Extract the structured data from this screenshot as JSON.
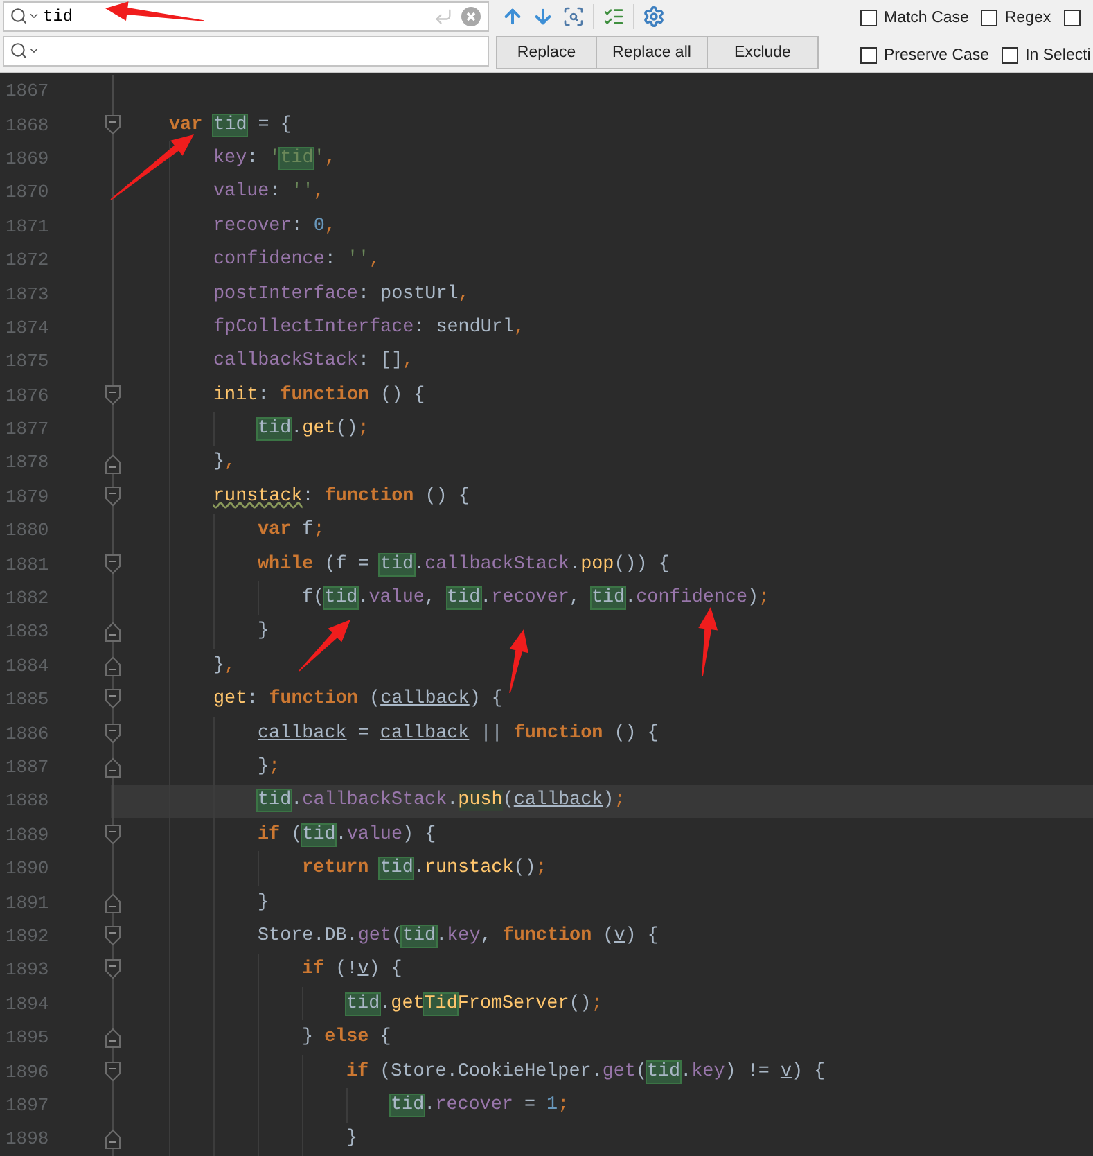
{
  "find_bar": {
    "search": {
      "value": "tid"
    },
    "buttons": [
      {
        "label": "Replace"
      },
      {
        "label": "Replace all"
      },
      {
        "label": "Exclude"
      }
    ],
    "options": [
      {
        "label": "Match Case",
        "checked": false
      },
      {
        "label": "Regex",
        "checked": false
      },
      {
        "checked": false
      },
      {
        "label": "Preserve Case",
        "checked": false
      },
      {
        "label": "In Selecti",
        "checked": false
      }
    ]
  },
  "editor": {
    "lines": [
      {
        "number": "1867",
        "kind": "code",
        "current": false
      },
      {
        "number": "1868",
        "kind": "block_start",
        "current": false,
        "tokens": [
          {
            "text": "var ",
            "kind": "kw"
          },
          {
            "text": "tid",
            "kind": "match"
          },
          {
            "text": " = {",
            "kind": "plain"
          }
        ],
        "children": [
          {
            "number": "1869",
            "kind": "code",
            "current": false,
            "tokens": [
              {
                "text": "key",
                "kind": "prop"
              },
              {
                "text": ": ",
                "kind": "plain"
              },
              {
                "text": "'",
                "kind": "str"
              },
              {
                "text": "tid",
                "kind": "match_str"
              },
              {
                "text": "'",
                "kind": "str"
              },
              {
                "text": ",",
                "kind": "punct"
              }
            ]
          },
          {
            "number": "1870",
            "kind": "code",
            "current": false,
            "tokens": [
              {
                "text": "value",
                "kind": "prop"
              },
              {
                "text": ": ",
                "kind": "plain"
              },
              {
                "text": "''",
                "kind": "str"
              },
              {
                "text": ",",
                "kind": "punct"
              }
            ]
          },
          {
            "number": "1871",
            "kind": "code",
            "current": false,
            "tokens": [
              {
                "text": "recover",
                "kind": "prop"
              },
              {
                "text": ": ",
                "kind": "plain"
              },
              {
                "text": "0",
                "kind": "num"
              },
              {
                "text": ",",
                "kind": "punct"
              }
            ]
          },
          {
            "number": "1872",
            "kind": "code",
            "current": false,
            "tokens": [
              {
                "text": "confidence",
                "kind": "prop"
              },
              {
                "text": ": ",
                "kind": "plain"
              },
              {
                "text": "''",
                "kind": "str"
              },
              {
                "text": ",",
                "kind": "punct"
              }
            ]
          },
          {
            "number": "1873",
            "kind": "code",
            "current": false,
            "tokens": [
              {
                "text": "postInterface",
                "kind": "prop"
              },
              {
                "text": ": postUrl",
                "kind": "plain"
              },
              {
                "text": ",",
                "kind": "punct"
              }
            ]
          },
          {
            "number": "1874",
            "kind": "code",
            "current": false,
            "tokens": [
              {
                "text": "fpCollectInterface",
                "kind": "prop"
              },
              {
                "text": ": sendUrl",
                "kind": "plain"
              },
              {
                "text": ",",
                "kind": "punct"
              }
            ]
          },
          {
            "number": "1875",
            "kind": "code",
            "current": false,
            "tokens": [
              {
                "text": "callbackStack",
                "kind": "prop"
              },
              {
                "text": ": []",
                "kind": "plain"
              },
              {
                "text": ",",
                "kind": "punct"
              }
            ]
          },
          {
            "number": "1876",
            "kind": "block_start",
            "current": false,
            "tokens": [
              {
                "text": "init",
                "kind": "fn"
              },
              {
                "text": ": ",
                "kind": "plain"
              },
              {
                "text": "function",
                "kind": "kw"
              },
              {
                "text": " () {",
                "kind": "plain"
              }
            ],
            "children": [
              {
                "number": "1877",
                "kind": "code",
                "current": false,
                "tokens": [
                  {
                    "text": "tid",
                    "kind": "match"
                  },
                  {
                    "text": ".",
                    "kind": "plain"
                  },
                  {
                    "text": "get",
                    "kind": "fn"
                  },
                  {
                    "text": "()",
                    "kind": "plain"
                  },
                  {
                    "text": ";",
                    "kind": "punct"
                  }
                ]
              }
            ]
          },
          {
            "number": "1878",
            "kind": "block_end",
            "current": false,
            "tokens": [
              {
                "text": "}",
                "kind": "plain"
              },
              {
                "text": ",",
                "kind": "punct"
              }
            ]
          },
          {
            "number": "1879",
            "kind": "block_start",
            "current": false,
            "tokens": [
              {
                "text": "runstack",
                "kind": "fn_warn"
              },
              {
                "text": ": ",
                "kind": "plain"
              },
              {
                "text": "function",
                "kind": "kw"
              },
              {
                "text": " () {",
                "kind": "plain"
              }
            ],
            "children": [
              {
                "number": "1880",
                "kind": "code",
                "current": false,
                "tokens": [
                  {
                    "text": "var",
                    "kind": "kw"
                  },
                  {
                    "text": " f",
                    "kind": "plain"
                  },
                  {
                    "text": ";",
                    "kind": "punct"
                  }
                ]
              },
              {
                "number": "1881",
                "kind": "block_start",
                "current": false,
                "tokens": [
                  {
                    "text": "while",
                    "kind": "kw"
                  },
                  {
                    "text": " (f = ",
                    "kind": "plain"
                  },
                  {
                    "text": "tid",
                    "kind": "match"
                  },
                  {
                    "text": ".",
                    "kind": "plain"
                  },
                  {
                    "text": "callbackStack",
                    "kind": "prop"
                  },
                  {
                    "text": ".",
                    "kind": "plain"
                  },
                  {
                    "text": "pop",
                    "kind": "fn"
                  },
                  {
                    "text": "()) {",
                    "kind": "plain"
                  }
                ],
                "children": [
                  {
                    "number": "1882",
                    "kind": "code",
                    "current": false,
                    "tokens": [
                      {
                        "text": "f(",
                        "kind": "plain"
                      },
                      {
                        "text": "tid",
                        "kind": "match"
                      },
                      {
                        "text": ".",
                        "kind": "plain"
                      },
                      {
                        "text": "value",
                        "kind": "prop"
                      },
                      {
                        "text": ", ",
                        "kind": "plain"
                      },
                      {
                        "text": "tid",
                        "kind": "match"
                      },
                      {
                        "text": ".",
                        "kind": "plain"
                      },
                      {
                        "text": "recover",
                        "kind": "prop"
                      },
                      {
                        "text": ", ",
                        "kind": "plain"
                      },
                      {
                        "text": "tid",
                        "kind": "match"
                      },
                      {
                        "text": ".",
                        "kind": "plain"
                      },
                      {
                        "text": "confidence",
                        "kind": "prop"
                      },
                      {
                        "text": ")",
                        "kind": "plain"
                      },
                      {
                        "text": ";",
                        "kind": "punct"
                      }
                    ]
                  }
                ]
              },
              {
                "number": "1883",
                "kind": "block_end",
                "current": false,
                "tokens": [
                  {
                    "text": "}",
                    "kind": "plain"
                  }
                ]
              }
            ]
          },
          {
            "number": "1884",
            "kind": "block_end",
            "current": false,
            "tokens": [
              {
                "text": "}",
                "kind": "plain"
              },
              {
                "text": ",",
                "kind": "punct"
              }
            ]
          },
          {
            "number": "1885",
            "kind": "block_start",
            "current": false,
            "tokens": [
              {
                "text": "get",
                "kind": "fn"
              },
              {
                "text": ": ",
                "kind": "plain"
              },
              {
                "text": "function",
                "kind": "kw"
              },
              {
                "text": " (",
                "kind": "plain"
              },
              {
                "text": "callback",
                "kind": "param"
              },
              {
                "text": ") {",
                "kind": "plain"
              }
            ],
            "children": [
              {
                "number": "1886",
                "kind": "block_start",
                "current": false,
                "tokens": [
                  {
                    "text": "callback",
                    "kind": "param"
                  },
                  {
                    "text": " = ",
                    "kind": "plain"
                  },
                  {
                    "text": "callback",
                    "kind": "param"
                  },
                  {
                    "text": " || ",
                    "kind": "plain"
                  },
                  {
                    "text": "function",
                    "kind": "kw"
                  },
                  {
                    "text": " () {",
                    "kind": "plain"
                  }
                ]
              },
              {
                "number": "1887",
                "kind": "block_end",
                "current": false,
                "tokens": [
                  {
                    "text": "}",
                    "kind": "plain"
                  },
                  {
                    "text": ";",
                    "kind": "punct"
                  }
                ]
              },
              {
                "number": "1888",
                "kind": "code",
                "current": true,
                "tokens": [
                  {
                    "text": "tid",
                    "kind": "match"
                  },
                  {
                    "text": ".",
                    "kind": "plain"
                  },
                  {
                    "text": "callbackStack",
                    "kind": "prop"
                  },
                  {
                    "text": ".",
                    "kind": "plain"
                  },
                  {
                    "text": "push",
                    "kind": "fn_hl"
                  },
                  {
                    "text": "(",
                    "kind": "plain"
                  },
                  {
                    "text": "callback",
                    "kind": "param"
                  },
                  {
                    "text": ")",
                    "kind": "plain"
                  },
                  {
                    "text": ";",
                    "kind": "punct"
                  }
                ]
              },
              {
                "number": "1889",
                "kind": "block_start",
                "current": false,
                "tokens": [
                  {
                    "text": "if",
                    "kind": "kw"
                  },
                  {
                    "text": " (",
                    "kind": "plain"
                  },
                  {
                    "text": "tid",
                    "kind": "match"
                  },
                  {
                    "text": ".",
                    "kind": "plain"
                  },
                  {
                    "text": "value",
                    "kind": "prop"
                  },
                  {
                    "text": ") {",
                    "kind": "plain"
                  }
                ],
                "children": [
                  {
                    "number": "1890",
                    "kind": "code",
                    "current": false,
                    "tokens": [
                      {
                        "text": "return ",
                        "kind": "kw"
                      },
                      {
                        "text": "tid",
                        "kind": "match"
                      },
                      {
                        "text": ".",
                        "kind": "plain"
                      },
                      {
                        "text": "runstack",
                        "kind": "fn"
                      },
                      {
                        "text": "()",
                        "kind": "plain"
                      },
                      {
                        "text": ";",
                        "kind": "punct"
                      }
                    ]
                  }
                ]
              },
              {
                "number": "1891",
                "kind": "block_end",
                "current": false,
                "tokens": [
                  {
                    "text": "}",
                    "kind": "plain"
                  }
                ]
              },
              {
                "number": "1892",
                "kind": "block_start",
                "current": false,
                "tokens": [
                  {
                    "text": "Store.DB.",
                    "kind": "plain"
                  },
                  {
                    "text": "get",
                    "kind": "prop"
                  },
                  {
                    "text": "(",
                    "kind": "plain"
                  },
                  {
                    "text": "tid",
                    "kind": "match"
                  },
                  {
                    "text": ".",
                    "kind": "plain"
                  },
                  {
                    "text": "key",
                    "kind": "prop"
                  },
                  {
                    "text": ", ",
                    "kind": "plain"
                  },
                  {
                    "text": "function",
                    "kind": "kw"
                  },
                  {
                    "text": " (",
                    "kind": "plain"
                  },
                  {
                    "text": "v",
                    "kind": "param"
                  },
                  {
                    "text": ") {",
                    "kind": "plain"
                  }
                ],
                "children": [
                  {
                    "number": "1893",
                    "kind": "block_start",
                    "current": false,
                    "tokens": [
                      {
                        "text": "if",
                        "kind": "kw"
                      },
                      {
                        "text": " (!",
                        "kind": "plain"
                      },
                      {
                        "text": "v",
                        "kind": "param"
                      },
                      {
                        "text": ") {",
                        "kind": "plain"
                      }
                    ],
                    "children": [
                      {
                        "number": "1894",
                        "kind": "code",
                        "current": false,
                        "tokens": [
                          {
                            "text": "tid",
                            "kind": "match"
                          },
                          {
                            "text": ".",
                            "kind": "plain"
                          },
                          {
                            "text": "get",
                            "kind": "fn"
                          },
                          {
                            "text": "Tid",
                            "kind": "match_fn"
                          },
                          {
                            "text": "FromServer",
                            "kind": "fn"
                          },
                          {
                            "text": "()",
                            "kind": "plain"
                          },
                          {
                            "text": ";",
                            "kind": "punct"
                          }
                        ]
                      }
                    ]
                  },
                  {
                    "number": "1895",
                    "kind": "block_end",
                    "current": false,
                    "tokens": [
                      {
                        "text": "} ",
                        "kind": "plain"
                      },
                      {
                        "text": "else",
                        "kind": "kw"
                      },
                      {
                        "text": " {",
                        "kind": "plain"
                      }
                    ],
                    "children": [
                      {
                        "number": "1896",
                        "kind": "block_start",
                        "current": false,
                        "tokens": [
                          {
                            "text": "if",
                            "kind": "kw"
                          },
                          {
                            "text": " (Store.CookieHelper.",
                            "kind": "plain"
                          },
                          {
                            "text": "get",
                            "kind": "prop"
                          },
                          {
                            "text": "(",
                            "kind": "plain"
                          },
                          {
                            "text": "tid",
                            "kind": "match"
                          },
                          {
                            "text": ".",
                            "kind": "plain"
                          },
                          {
                            "text": "key",
                            "kind": "prop"
                          },
                          {
                            "text": ") != ",
                            "kind": "plain"
                          },
                          {
                            "text": "v",
                            "kind": "param"
                          },
                          {
                            "text": ") {",
                            "kind": "plain"
                          }
                        ],
                        "children": [
                          {
                            "number": "1897",
                            "kind": "code",
                            "current": false,
                            "tokens": [
                              {
                                "text": "tid",
                                "kind": "match"
                              },
                              {
                                "text": ".",
                                "kind": "plain"
                              },
                              {
                                "text": "recover",
                                "kind": "prop"
                              },
                              {
                                "text": " = ",
                                "kind": "plain"
                              },
                              {
                                "text": "1",
                                "kind": "num"
                              },
                              {
                                "text": ";",
                                "kind": "punct"
                              }
                            ]
                          }
                        ]
                      },
                      {
                        "number": "1898",
                        "kind": "block_end",
                        "current": false,
                        "tokens": [
                          {
                            "text": "}",
                            "kind": "plain"
                          }
                        ]
                      }
                    ]
                  }
                ]
              }
            ]
          }
        ]
      }
    ]
  }
}
